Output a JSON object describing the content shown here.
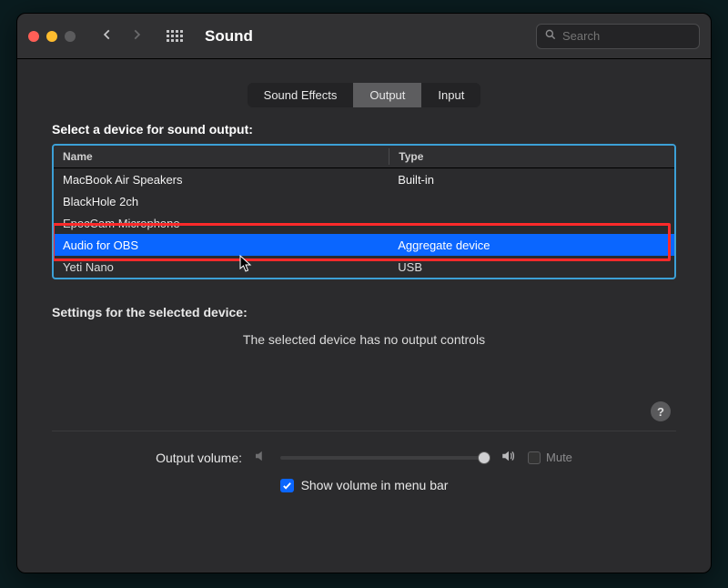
{
  "window": {
    "title": "Sound"
  },
  "search": {
    "placeholder": "Search"
  },
  "tabs": [
    {
      "label": "Sound Effects",
      "active": false
    },
    {
      "label": "Output",
      "active": true
    },
    {
      "label": "Input",
      "active": false
    }
  ],
  "section_label": "Select a device for sound output:",
  "table": {
    "columns": {
      "name": "Name",
      "type": "Type"
    },
    "rows": [
      {
        "name": "MacBook Air Speakers",
        "type": "Built-in",
        "selected": false
      },
      {
        "name": "BlackHole 2ch",
        "type": "",
        "selected": false
      },
      {
        "name": "EpocCam Microphone",
        "type": "",
        "selected": false
      },
      {
        "name": "Audio for OBS",
        "type": "Aggregate device",
        "selected": true
      },
      {
        "name": "Yeti Nano",
        "type": "USB",
        "selected": false
      }
    ]
  },
  "settings_label": "Settings for the selected device:",
  "no_controls": "The selected device has no output controls",
  "volume": {
    "label": "Output volume:",
    "mute_label": "Mute",
    "show_in_menu_label": "Show volume in menu bar",
    "show_in_menu_checked": true
  },
  "help_glyph": "?"
}
